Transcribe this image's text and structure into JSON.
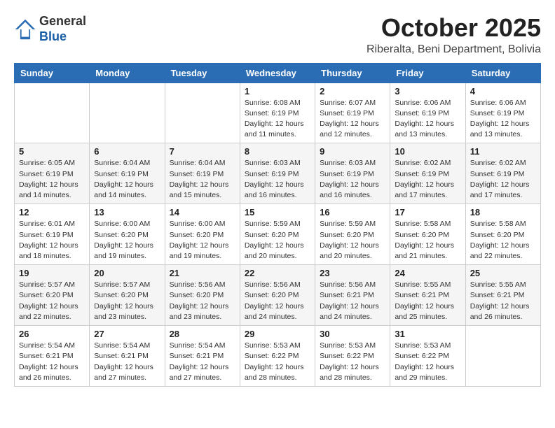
{
  "logo": {
    "general": "General",
    "blue": "Blue"
  },
  "header": {
    "month": "October 2025",
    "location": "Riberalta, Beni Department, Bolivia"
  },
  "weekdays": [
    "Sunday",
    "Monday",
    "Tuesday",
    "Wednesday",
    "Thursday",
    "Friday",
    "Saturday"
  ],
  "weeks": [
    [
      {
        "day": "",
        "info": ""
      },
      {
        "day": "",
        "info": ""
      },
      {
        "day": "",
        "info": ""
      },
      {
        "day": "1",
        "info": "Sunrise: 6:08 AM\nSunset: 6:19 PM\nDaylight: 12 hours\nand 11 minutes."
      },
      {
        "day": "2",
        "info": "Sunrise: 6:07 AM\nSunset: 6:19 PM\nDaylight: 12 hours\nand 12 minutes."
      },
      {
        "day": "3",
        "info": "Sunrise: 6:06 AM\nSunset: 6:19 PM\nDaylight: 12 hours\nand 13 minutes."
      },
      {
        "day": "4",
        "info": "Sunrise: 6:06 AM\nSunset: 6:19 PM\nDaylight: 12 hours\nand 13 minutes."
      }
    ],
    [
      {
        "day": "5",
        "info": "Sunrise: 6:05 AM\nSunset: 6:19 PM\nDaylight: 12 hours\nand 14 minutes."
      },
      {
        "day": "6",
        "info": "Sunrise: 6:04 AM\nSunset: 6:19 PM\nDaylight: 12 hours\nand 14 minutes."
      },
      {
        "day": "7",
        "info": "Sunrise: 6:04 AM\nSunset: 6:19 PM\nDaylight: 12 hours\nand 15 minutes."
      },
      {
        "day": "8",
        "info": "Sunrise: 6:03 AM\nSunset: 6:19 PM\nDaylight: 12 hours\nand 16 minutes."
      },
      {
        "day": "9",
        "info": "Sunrise: 6:03 AM\nSunset: 6:19 PM\nDaylight: 12 hours\nand 16 minutes."
      },
      {
        "day": "10",
        "info": "Sunrise: 6:02 AM\nSunset: 6:19 PM\nDaylight: 12 hours\nand 17 minutes."
      },
      {
        "day": "11",
        "info": "Sunrise: 6:02 AM\nSunset: 6:19 PM\nDaylight: 12 hours\nand 17 minutes."
      }
    ],
    [
      {
        "day": "12",
        "info": "Sunrise: 6:01 AM\nSunset: 6:19 PM\nDaylight: 12 hours\nand 18 minutes."
      },
      {
        "day": "13",
        "info": "Sunrise: 6:00 AM\nSunset: 6:20 PM\nDaylight: 12 hours\nand 19 minutes."
      },
      {
        "day": "14",
        "info": "Sunrise: 6:00 AM\nSunset: 6:20 PM\nDaylight: 12 hours\nand 19 minutes."
      },
      {
        "day": "15",
        "info": "Sunrise: 5:59 AM\nSunset: 6:20 PM\nDaylight: 12 hours\nand 20 minutes."
      },
      {
        "day": "16",
        "info": "Sunrise: 5:59 AM\nSunset: 6:20 PM\nDaylight: 12 hours\nand 20 minutes."
      },
      {
        "day": "17",
        "info": "Sunrise: 5:58 AM\nSunset: 6:20 PM\nDaylight: 12 hours\nand 21 minutes."
      },
      {
        "day": "18",
        "info": "Sunrise: 5:58 AM\nSunset: 6:20 PM\nDaylight: 12 hours\nand 22 minutes."
      }
    ],
    [
      {
        "day": "19",
        "info": "Sunrise: 5:57 AM\nSunset: 6:20 PM\nDaylight: 12 hours\nand 22 minutes."
      },
      {
        "day": "20",
        "info": "Sunrise: 5:57 AM\nSunset: 6:20 PM\nDaylight: 12 hours\nand 23 minutes."
      },
      {
        "day": "21",
        "info": "Sunrise: 5:56 AM\nSunset: 6:20 PM\nDaylight: 12 hours\nand 23 minutes."
      },
      {
        "day": "22",
        "info": "Sunrise: 5:56 AM\nSunset: 6:20 PM\nDaylight: 12 hours\nand 24 minutes."
      },
      {
        "day": "23",
        "info": "Sunrise: 5:56 AM\nSunset: 6:21 PM\nDaylight: 12 hours\nand 24 minutes."
      },
      {
        "day": "24",
        "info": "Sunrise: 5:55 AM\nSunset: 6:21 PM\nDaylight: 12 hours\nand 25 minutes."
      },
      {
        "day": "25",
        "info": "Sunrise: 5:55 AM\nSunset: 6:21 PM\nDaylight: 12 hours\nand 26 minutes."
      }
    ],
    [
      {
        "day": "26",
        "info": "Sunrise: 5:54 AM\nSunset: 6:21 PM\nDaylight: 12 hours\nand 26 minutes."
      },
      {
        "day": "27",
        "info": "Sunrise: 5:54 AM\nSunset: 6:21 PM\nDaylight: 12 hours\nand 27 minutes."
      },
      {
        "day": "28",
        "info": "Sunrise: 5:54 AM\nSunset: 6:21 PM\nDaylight: 12 hours\nand 27 minutes."
      },
      {
        "day": "29",
        "info": "Sunrise: 5:53 AM\nSunset: 6:22 PM\nDaylight: 12 hours\nand 28 minutes."
      },
      {
        "day": "30",
        "info": "Sunrise: 5:53 AM\nSunset: 6:22 PM\nDaylight: 12 hours\nand 28 minutes."
      },
      {
        "day": "31",
        "info": "Sunrise: 5:53 AM\nSunset: 6:22 PM\nDaylight: 12 hours\nand 29 minutes."
      },
      {
        "day": "",
        "info": ""
      }
    ]
  ]
}
